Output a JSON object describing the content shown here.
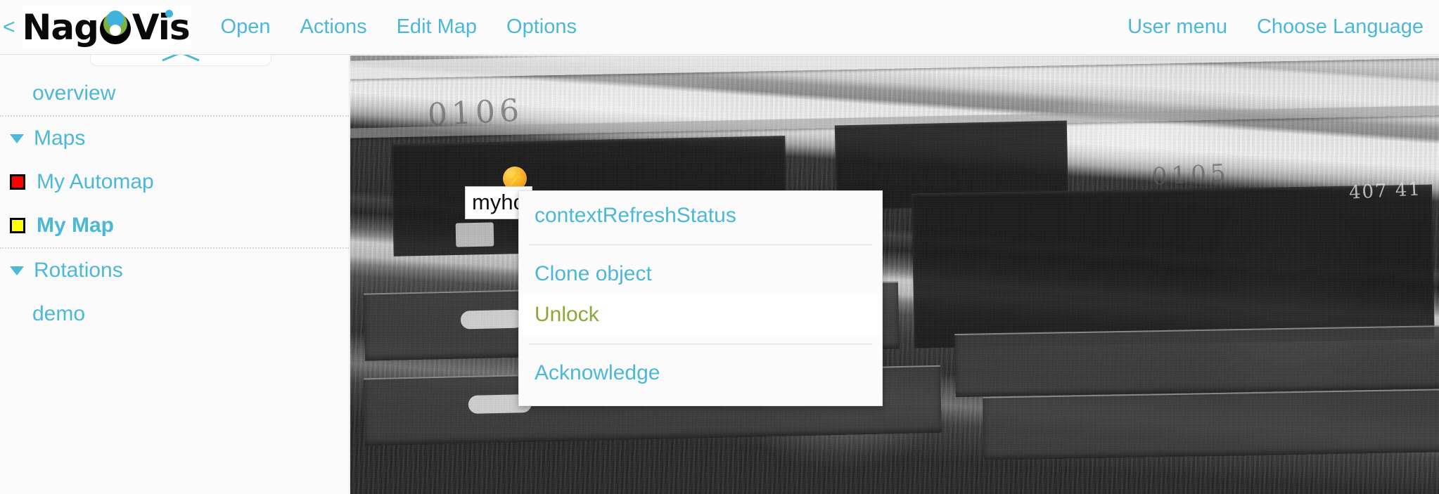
{
  "header": {
    "back_arrow": "<",
    "logo_text_left": "Nag",
    "logo_text_right": "Vis",
    "nav_left": [
      {
        "label": "Open",
        "name": "nav-open"
      },
      {
        "label": "Actions",
        "name": "nav-actions"
      },
      {
        "label": "Edit Map",
        "name": "nav-edit-map"
      },
      {
        "label": "Options",
        "name": "nav-options"
      }
    ],
    "nav_right": [
      {
        "label": "User menu",
        "name": "nav-user-menu"
      },
      {
        "label": "Choose Language",
        "name": "nav-choose-language"
      }
    ]
  },
  "sidebar": {
    "collapse_icon": "chevron-up-icon",
    "items": [
      {
        "label": "overview",
        "type": "link",
        "indent": true,
        "bold": false,
        "state": null
      },
      {
        "label": "Maps",
        "type": "group",
        "indent": false,
        "bold": false,
        "state": null
      },
      {
        "label": "My Automap",
        "type": "map",
        "indent": false,
        "bold": false,
        "state": "#ff0000"
      },
      {
        "label": "My Map",
        "type": "map",
        "indent": false,
        "bold": true,
        "state": "#ffff00"
      },
      {
        "label": "Rotations",
        "type": "group",
        "indent": false,
        "bold": false,
        "state": null
      },
      {
        "label": "demo",
        "type": "link",
        "indent": true,
        "bold": false,
        "state": null
      }
    ]
  },
  "map": {
    "object_label": "myho",
    "object_icon": "warning-bolt-icon",
    "photo_text": [
      "0106",
      "0105",
      "407 41"
    ]
  },
  "context_menu": {
    "items": [
      {
        "label": "contextRefreshStatus",
        "name": "menu-context-refresh-status",
        "hover": false
      },
      {
        "divider": true
      },
      {
        "label": "Clone object",
        "name": "menu-clone-object",
        "hover": false
      },
      {
        "label": "Unlock",
        "name": "menu-unlock",
        "hover": true
      },
      {
        "divider": true
      },
      {
        "label": "Acknowledge",
        "name": "menu-acknowledge",
        "hover": false
      }
    ]
  },
  "colors": {
    "accent": "#4cb8d8",
    "hover": "#8aa832",
    "warning": "#f5a623",
    "critical": "#ff0000",
    "background": "#fafafa"
  }
}
